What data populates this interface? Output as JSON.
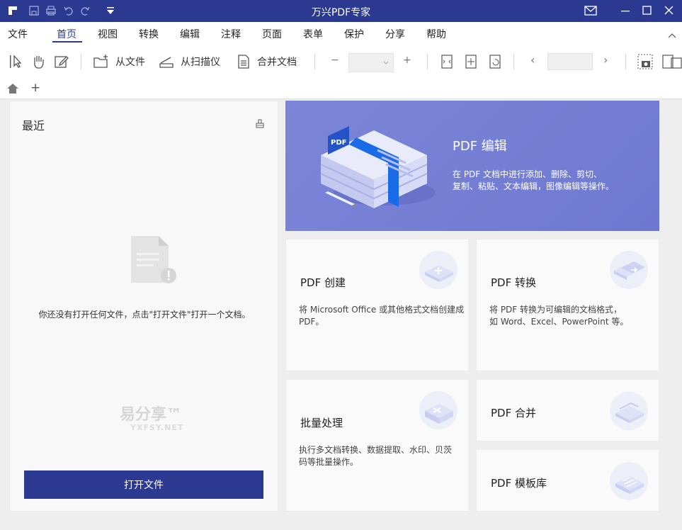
{
  "window": {
    "title": "万兴PDF专家"
  },
  "menu": {
    "items": [
      "文件",
      "首页",
      "视图",
      "转换",
      "编辑",
      "注释",
      "页面",
      "表单",
      "保护",
      "分享",
      "帮助"
    ],
    "active": "首页"
  },
  "toolbar": {
    "from_file": "从文件",
    "from_scanner": "从扫描仪",
    "merge_docs": "合并文档",
    "zoom_minus": "−",
    "zoom_plus": "+",
    "prev": "‹",
    "next": "›"
  },
  "tabbar": {
    "add": "+"
  },
  "recent": {
    "title": "最近",
    "empty_message": "你还没有打开任何文件，点击\"打开文件\"打开一个文档。",
    "open_button": "打开文件"
  },
  "watermark": {
    "main": "易分享™",
    "sub": "YXFSY.NET"
  },
  "hero": {
    "title": "PDF 编辑",
    "desc_line1": "在 PDF 文档中进行添加、删除、剪切、",
    "desc_line2": "复制、粘贴、文本编辑，图像编辑等操作。"
  },
  "cards": {
    "create": {
      "title": "PDF 创建",
      "desc_line1": "将 Microsoft Office 或其他格式文档创建成",
      "desc_line2": "PDF。"
    },
    "convert": {
      "title": "PDF 转换",
      "desc_line1": "将 PDF 转换为可编辑的文档格式，",
      "desc_line2": "如 Word、Excel、PowerPoint 等。"
    },
    "batch": {
      "title": "批量处理",
      "desc_line1": "执行多文档转换、数据提取、水印、贝茨",
      "desc_line2": "码等批量操作。"
    },
    "merge": {
      "title": "PDF 合并"
    },
    "templates": {
      "title": "PDF 模板库"
    }
  },
  "colors": {
    "brand": "#2b3990",
    "hero": "#7580d4"
  }
}
